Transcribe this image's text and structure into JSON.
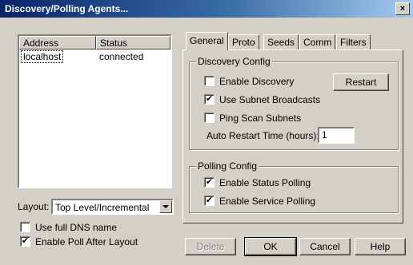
{
  "window": {
    "title": "Discovery/Polling Agents...",
    "close_glyph": "×"
  },
  "agents_list": {
    "columns": [
      "Address",
      "Status"
    ],
    "rows": [
      {
        "address": "localhost",
        "status": "connected"
      }
    ]
  },
  "layout": {
    "label": "Layout:",
    "selected": "Top Level/Incremental"
  },
  "options": {
    "full_dns": {
      "label": "Use full DNS name",
      "checked": false
    },
    "poll_after_layout": {
      "label": "Enable Poll After Layout",
      "checked": true
    }
  },
  "tabs": [
    {
      "label": "General",
      "active": true
    },
    {
      "label": "Proto",
      "active": false
    },
    {
      "label": "Seeds",
      "active": false
    },
    {
      "label": "Comm",
      "active": false
    },
    {
      "label": "Filters",
      "active": false
    }
  ],
  "discovery_config": {
    "title": "Discovery Config",
    "enable_discovery": {
      "label": "Enable Discovery",
      "checked": false
    },
    "subnet_broadcasts": {
      "label": "Use Subnet Broadcasts",
      "checked": true
    },
    "ping_scan": {
      "label": "Ping Scan Subnets",
      "checked": false
    },
    "restart_label": "Restart",
    "auto_restart_label": "Auto Restart Time (hours):",
    "auto_restart_value": "1"
  },
  "polling_config": {
    "title": "Polling Config",
    "status_polling": {
      "label": "Enable Status Polling",
      "checked": true
    },
    "service_polling": {
      "label": "Enable Service Polling",
      "checked": true
    }
  },
  "buttons": {
    "delete": "Delete",
    "ok": "OK",
    "cancel": "Cancel",
    "help": "Help"
  },
  "checkmark_glyph": "✔"
}
